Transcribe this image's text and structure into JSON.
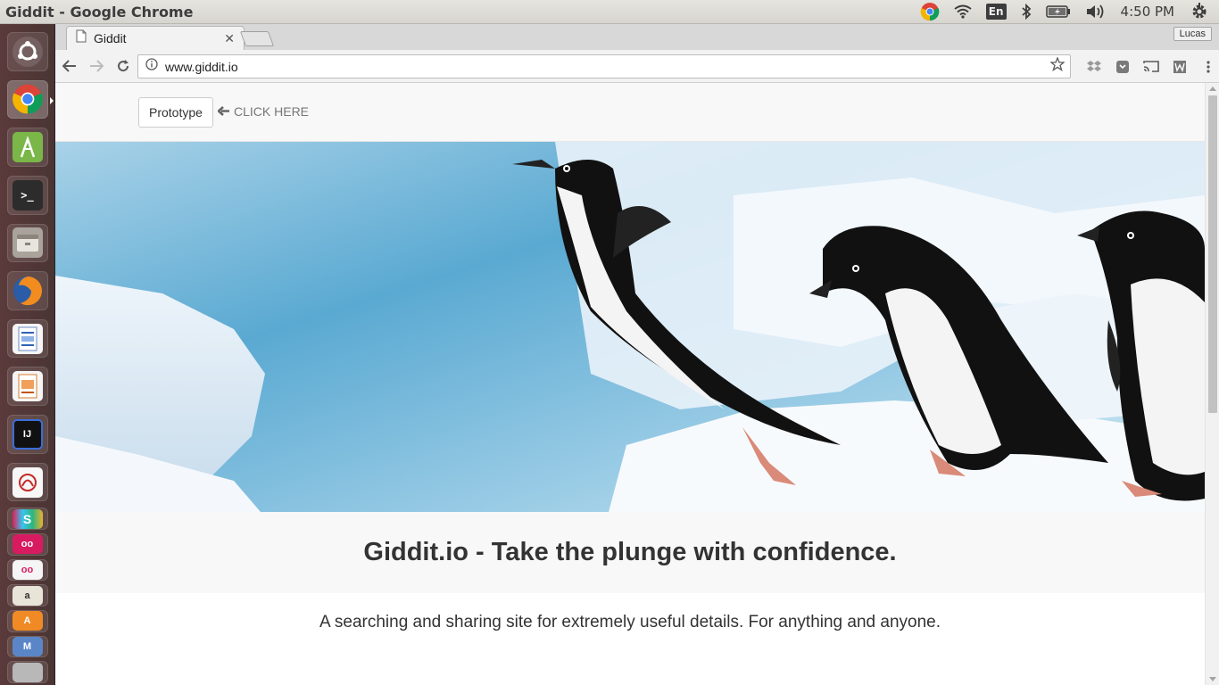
{
  "window": {
    "title": "Giddit - Google Chrome"
  },
  "panel": {
    "language": "En",
    "time": "4:50 PM",
    "indicators": [
      "chrome-icon",
      "wifi-icon",
      "keyboard-language",
      "bluetooth-icon",
      "battery-icon",
      "volume-icon",
      "clock",
      "system-gear-icon"
    ]
  },
  "launcher": {
    "items": [
      "ubuntu-dash",
      "google-chrome",
      "android-studio",
      "terminal",
      "files",
      "firefox",
      "libreoffice-writer",
      "libreoffice-impress",
      "intellij-idea",
      "document-viewer",
      "slack",
      "app-a",
      "app-b",
      "app-c",
      "app-d",
      "app-e",
      "app-f"
    ]
  },
  "browser": {
    "tab": {
      "title": "Giddit"
    },
    "profile": "Lucas",
    "url": "www.giddit.io"
  },
  "site": {
    "nav_button": "Prototype",
    "click_hint": "CLICK HERE",
    "tagline": "Giddit.io - Take the plunge with confidence.",
    "description": "A searching and sharing site for extremely useful details. For anything and anyone."
  },
  "colors": {
    "launcher_bg": "#4f3736",
    "panel_bg": "#dfddd7",
    "page_band": "#f8f8f8",
    "sky": "#6fb4d6"
  }
}
